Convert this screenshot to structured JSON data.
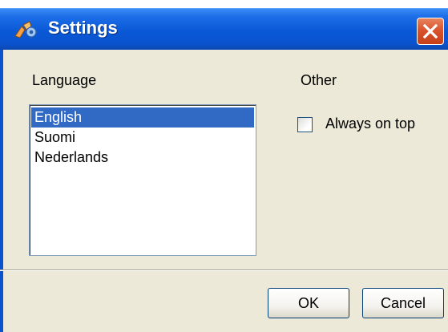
{
  "window": {
    "title": "Settings",
    "app_icon": "settings-app-icon"
  },
  "language": {
    "label": "Language",
    "items": [
      {
        "label": "English",
        "selected": true
      },
      {
        "label": "Suomi",
        "selected": false
      },
      {
        "label": "Nederlands",
        "selected": false
      }
    ]
  },
  "other": {
    "label": "Other",
    "always_on_top": {
      "label": "Always on top",
      "checked": false
    }
  },
  "buttons": {
    "ok": "OK",
    "cancel": "Cancel"
  },
  "colors": {
    "titlebar": "#0a58d6",
    "selection": "#316ac5",
    "close": "#d9542c",
    "dialog_bg": "#ece9d8"
  }
}
